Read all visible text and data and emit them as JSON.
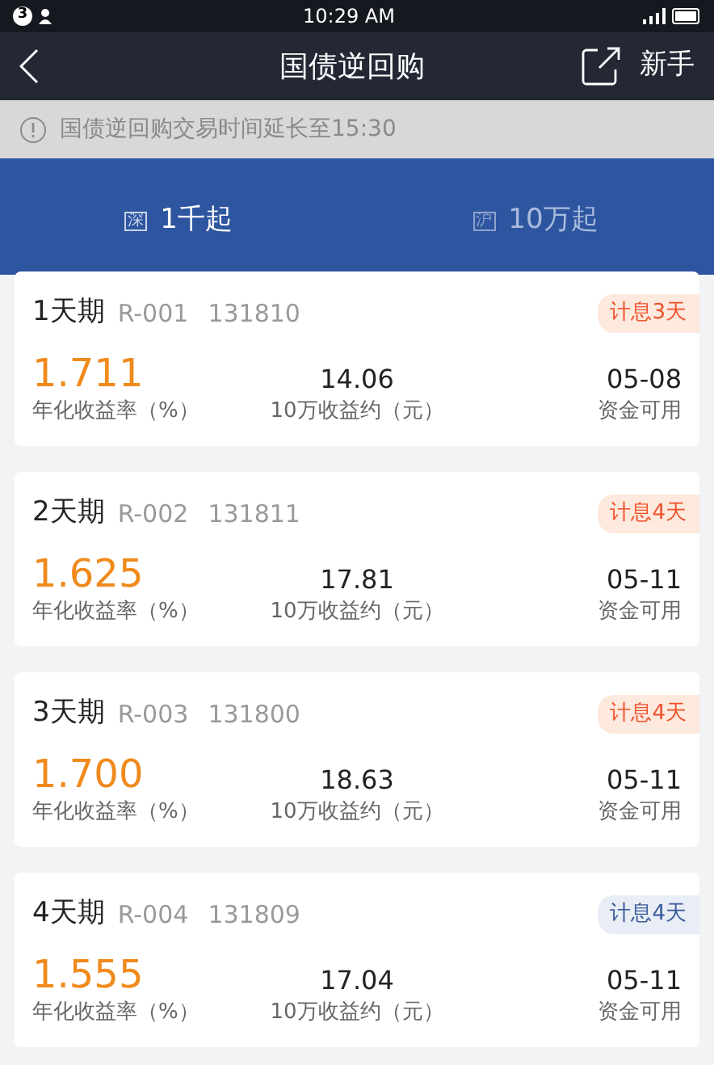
{
  "status_bar": {
    "badge": "3",
    "time": "10:29 AM"
  },
  "header": {
    "title": "国债逆回购",
    "action": "新手"
  },
  "notice": "国债逆回购交易时间延长至15:30",
  "tabs": [
    {
      "market": "深",
      "label": "1千起",
      "selected": true
    },
    {
      "market": "沪",
      "label": "10万起",
      "selected": false
    }
  ],
  "products": [
    {
      "term": "1天期",
      "code": "R-001",
      "number": "131810",
      "tag": "计息3天",
      "color": "#f0522d",
      "rate": "1.711",
      "rate_label": "年化收益率（%）",
      "income": "14.06",
      "income_label": "10万收益约（元）",
      "date": "05-08",
      "date_label": "资金可用"
    },
    {
      "term": "2天期",
      "code": "R-002",
      "number": "131811",
      "tag": "计息4天",
      "color": "#f0522d",
      "rate": "1.625",
      "rate_label": "年化收益率（%）",
      "income": "17.81",
      "income_label": "10万收益约（元）",
      "date": "05-11",
      "date_label": "资金可用"
    },
    {
      "term": "3天期",
      "code": "R-003",
      "number": "131800",
      "tag": "计息4天",
      "color": "#f0522d",
      "rate": "1.700",
      "rate_label": "年化收益率（%）",
      "income": "18.63",
      "income_label": "10万收益约（元）",
      "date": "05-11",
      "date_label": "资金可用"
    },
    {
      "term": "4天期",
      "code": "R-004",
      "number": "131809",
      "tag": "计息4天",
      "color": "#3a5a9a",
      "rate": "1.555",
      "rate_label": "年化收益率（%）",
      "income": "17.04",
      "income_label": "10万收益约（元）",
      "date": "05-11",
      "date_label": "资金可用"
    }
  ]
}
